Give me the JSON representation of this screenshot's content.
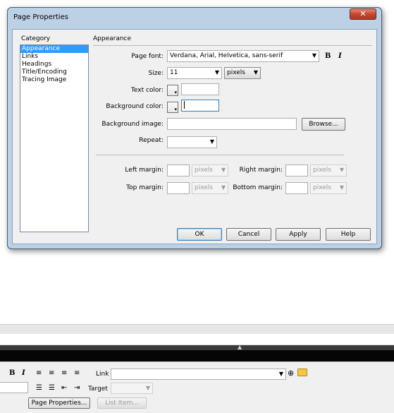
{
  "dialog": {
    "title": "Page Properties",
    "close_glyph": "✕",
    "category_label": "Category",
    "categories": [
      "Appearance",
      "Links",
      "Headings",
      "Title/Encoding",
      "Tracing Image"
    ],
    "selected_category": "Appearance",
    "section_title": "Appearance",
    "page_font_label": "Page font:",
    "page_font_value": "Verdana, Arial, Helvetica, sans-serif",
    "bold_glyph": "B",
    "italic_glyph": "I",
    "size_label": "Size:",
    "size_value": "11",
    "size_unit": "pixels",
    "text_color_label": "Text color:",
    "text_color_value": "",
    "bg_color_label": "Background color:",
    "bg_color_value": "",
    "bg_image_label": "Background image:",
    "bg_image_value": "",
    "browse_label": "Browse...",
    "repeat_label": "Repeat:",
    "repeat_value": "",
    "left_margin_label": "Left margin:",
    "right_margin_label": "Right margin:",
    "top_margin_label": "Top margin:",
    "bottom_margin_label": "Bottom margin:",
    "margin_unit": "pixels",
    "ok_label": "OK",
    "cancel_label": "Cancel",
    "apply_label": "Apply",
    "help_label": "Help"
  },
  "property_inspector": {
    "bold_glyph": "B",
    "italic_glyph": "I",
    "link_label": "Link",
    "link_value": "",
    "target_label": "Target",
    "target_value": "",
    "page_properties_label": "Page Properties...",
    "list_item_label": "List Item..."
  },
  "colors": {
    "dialog_frame": "#bcd0e6",
    "selection": "#3399ff",
    "close_button": "#c4432b"
  }
}
